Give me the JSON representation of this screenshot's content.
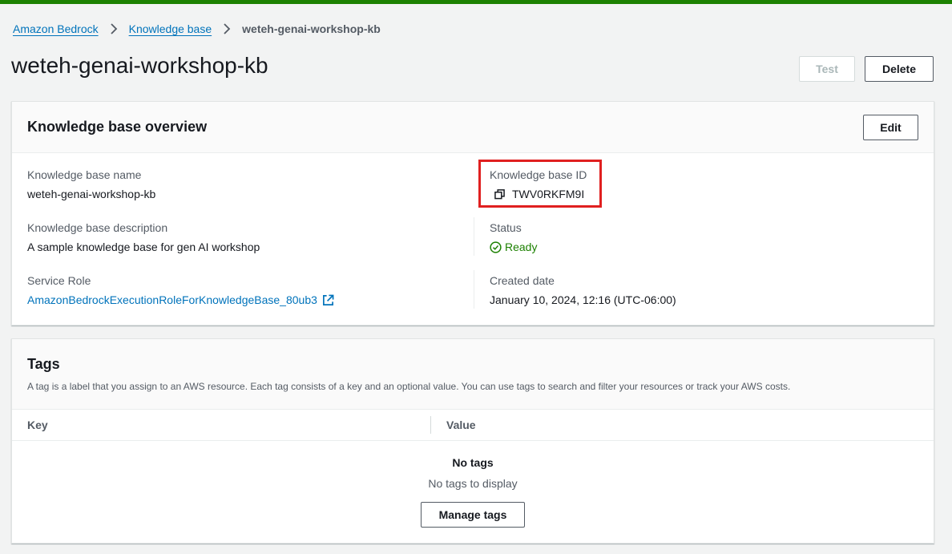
{
  "breadcrumb": {
    "items": [
      "Amazon Bedrock",
      "Knowledge base"
    ],
    "current": "weteh-genai-workshop-kb"
  },
  "page": {
    "title": "weteh-genai-workshop-kb",
    "test_label": "Test",
    "delete_label": "Delete"
  },
  "overview": {
    "title": "Knowledge base overview",
    "edit_label": "Edit",
    "name_label": "Knowledge base name",
    "name_value": "weteh-genai-workshop-kb",
    "description_label": "Knowledge base description",
    "description_value": "A sample knowledge base for gen AI workshop",
    "service_role_label": "Service Role",
    "service_role_value": "AmazonBedrockExecutionRoleForKnowledgeBase_80ub3",
    "id_label": "Knowledge base ID",
    "id_value": "TWV0RKFM9I",
    "status_label": "Status",
    "status_value": "Ready",
    "created_label": "Created date",
    "created_value": "January 10, 2024, 12:16 (UTC-06:00)"
  },
  "tags": {
    "title": "Tags",
    "description": "A tag is a label that you assign to an AWS resource. Each tag consists of a key and an optional value. You can use tags to search and filter your resources or track your AWS costs.",
    "columns": [
      "Key",
      "Value"
    ],
    "empty_title": "No tags",
    "empty_text": "No tags to display",
    "manage_label": "Manage tags"
  },
  "colors": {
    "top_bar": "#1d8102",
    "link": "#0073bb",
    "status_ready": "#1d8102",
    "highlight": "#e02020"
  },
  "icons": {
    "separator": "chevron-right-icon",
    "copy": "copy-icon",
    "external": "external-link-icon",
    "status": "check-circle-icon"
  }
}
